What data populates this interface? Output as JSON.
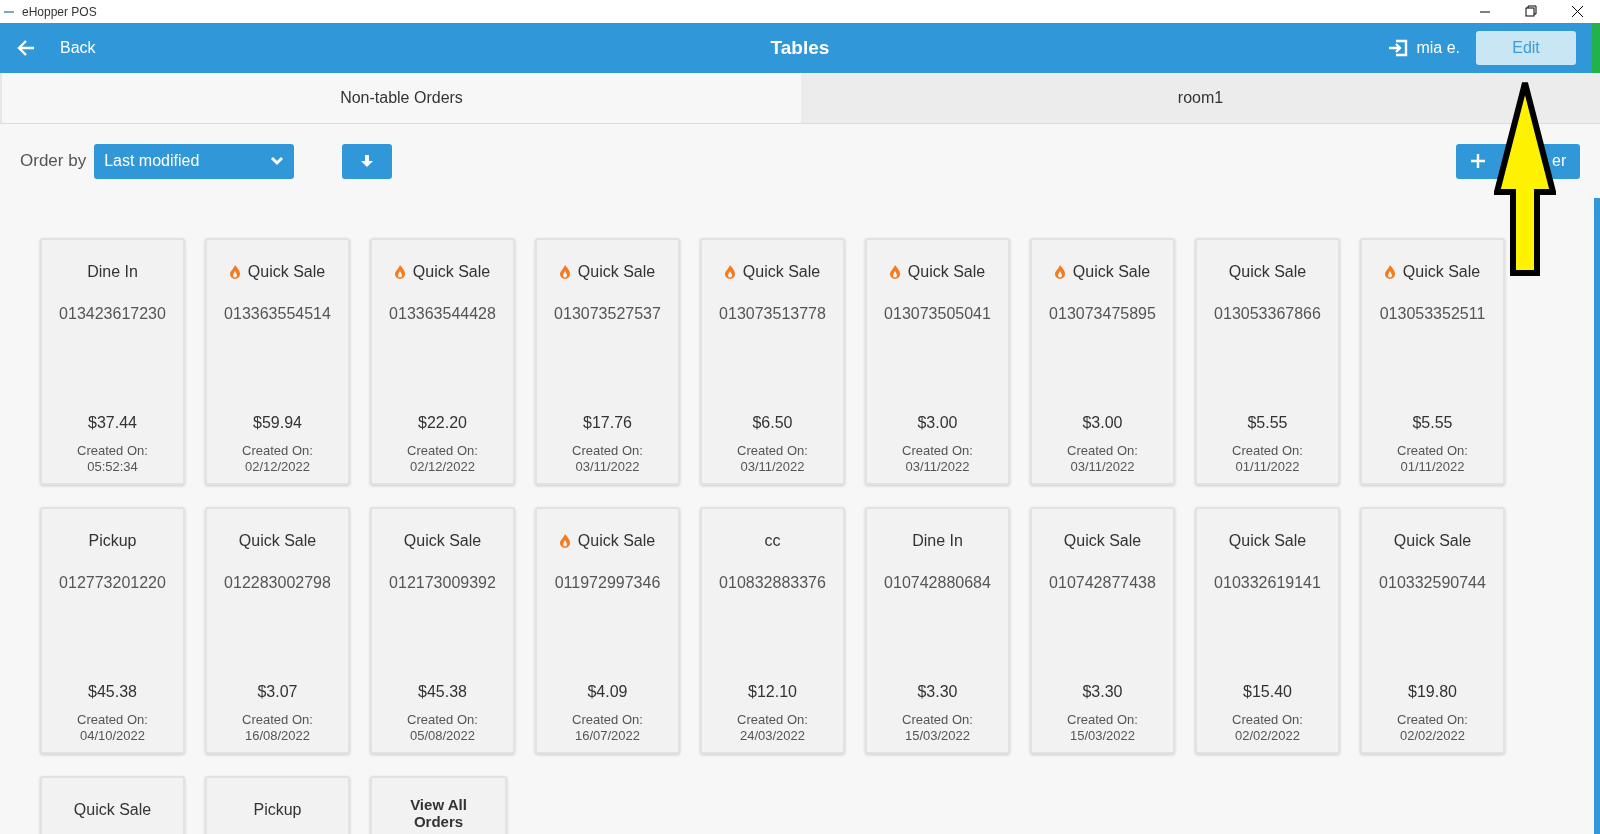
{
  "window": {
    "title": "eHopper POS"
  },
  "header": {
    "back": "Back",
    "title": "Tables",
    "user": "mia e.",
    "edit_button": "Edit"
  },
  "tabs": [
    {
      "label": "Non-table Orders",
      "selected": true
    },
    {
      "label": "room1",
      "selected": false
    }
  ],
  "toolbar": {
    "order_by_label": "Order by",
    "order_by_value": "Last modified",
    "new_order_label_visible": "er"
  },
  "orders": [
    {
      "kind": "order",
      "type": "Dine In",
      "flame": false,
      "number": "013423617230",
      "amount": "$37.44",
      "created_label": "Created On:",
      "created": "05:52:34"
    },
    {
      "kind": "order",
      "type": "Quick Sale",
      "flame": true,
      "number": "013363554514",
      "amount": "$59.94",
      "created_label": "Created On:",
      "created": "02/12/2022"
    },
    {
      "kind": "order",
      "type": "Quick Sale",
      "flame": true,
      "number": "013363544428",
      "amount": "$22.20",
      "created_label": "Created On:",
      "created": "02/12/2022"
    },
    {
      "kind": "order",
      "type": "Quick Sale",
      "flame": true,
      "number": "013073527537",
      "amount": "$17.76",
      "created_label": "Created On:",
      "created": "03/11/2022"
    },
    {
      "kind": "order",
      "type": "Quick Sale",
      "flame": true,
      "number": "013073513778",
      "amount": "$6.50",
      "created_label": "Created On:",
      "created": "03/11/2022"
    },
    {
      "kind": "order",
      "type": "Quick Sale",
      "flame": true,
      "number": "013073505041",
      "amount": "$3.00",
      "created_label": "Created On:",
      "created": "03/11/2022"
    },
    {
      "kind": "order",
      "type": "Quick Sale",
      "flame": true,
      "number": "013073475895",
      "amount": "$3.00",
      "created_label": "Created On:",
      "created": "03/11/2022"
    },
    {
      "kind": "order",
      "type": "Quick Sale",
      "flame": false,
      "number": "013053367866",
      "amount": "$5.55",
      "created_label": "Created On:",
      "created": "01/11/2022"
    },
    {
      "kind": "order",
      "type": "Quick Sale",
      "flame": true,
      "number": "013053352511",
      "amount": "$5.55",
      "created_label": "Created On:",
      "created": "01/11/2022"
    },
    {
      "kind": "order",
      "type": "Pickup",
      "flame": false,
      "number": "012773201220",
      "amount": "$45.38",
      "created_label": "Created On:",
      "created": "04/10/2022"
    },
    {
      "kind": "order",
      "type": "Quick Sale",
      "flame": false,
      "number": "012283002798",
      "amount": "$3.07",
      "created_label": "Created On:",
      "created": "16/08/2022"
    },
    {
      "kind": "order",
      "type": "Quick Sale",
      "flame": false,
      "number": "012173009392",
      "amount": "$45.38",
      "created_label": "Created On:",
      "created": "05/08/2022"
    },
    {
      "kind": "order",
      "type": "Quick Sale",
      "flame": true,
      "number": "011972997346",
      "amount": "$4.09",
      "created_label": "Created On:",
      "created": "16/07/2022"
    },
    {
      "kind": "order",
      "type": "cc",
      "flame": false,
      "number": "010832883376",
      "amount": "$12.10",
      "created_label": "Created On:",
      "created": "24/03/2022"
    },
    {
      "kind": "order",
      "type": "Dine In",
      "flame": false,
      "number": "010742880684",
      "amount": "$3.30",
      "created_label": "Created On:",
      "created": "15/03/2022"
    },
    {
      "kind": "order",
      "type": "Quick Sale",
      "flame": false,
      "number": "010742877438",
      "amount": "$3.30",
      "created_label": "Created On:",
      "created": "15/03/2022"
    },
    {
      "kind": "order",
      "type": "Quick Sale",
      "flame": false,
      "number": "010332619141",
      "amount": "$15.40",
      "created_label": "Created On:",
      "created": "02/02/2022"
    },
    {
      "kind": "order",
      "type": "Quick Sale",
      "flame": false,
      "number": "010332590744",
      "amount": "$19.80",
      "created_label": "Created On:",
      "created": "02/02/2022"
    },
    {
      "kind": "order",
      "type": "Quick Sale",
      "flame": false
    },
    {
      "kind": "order",
      "type": "Pickup",
      "flame": false
    },
    {
      "kind": "view_all",
      "type": "View All Orders"
    }
  ]
}
